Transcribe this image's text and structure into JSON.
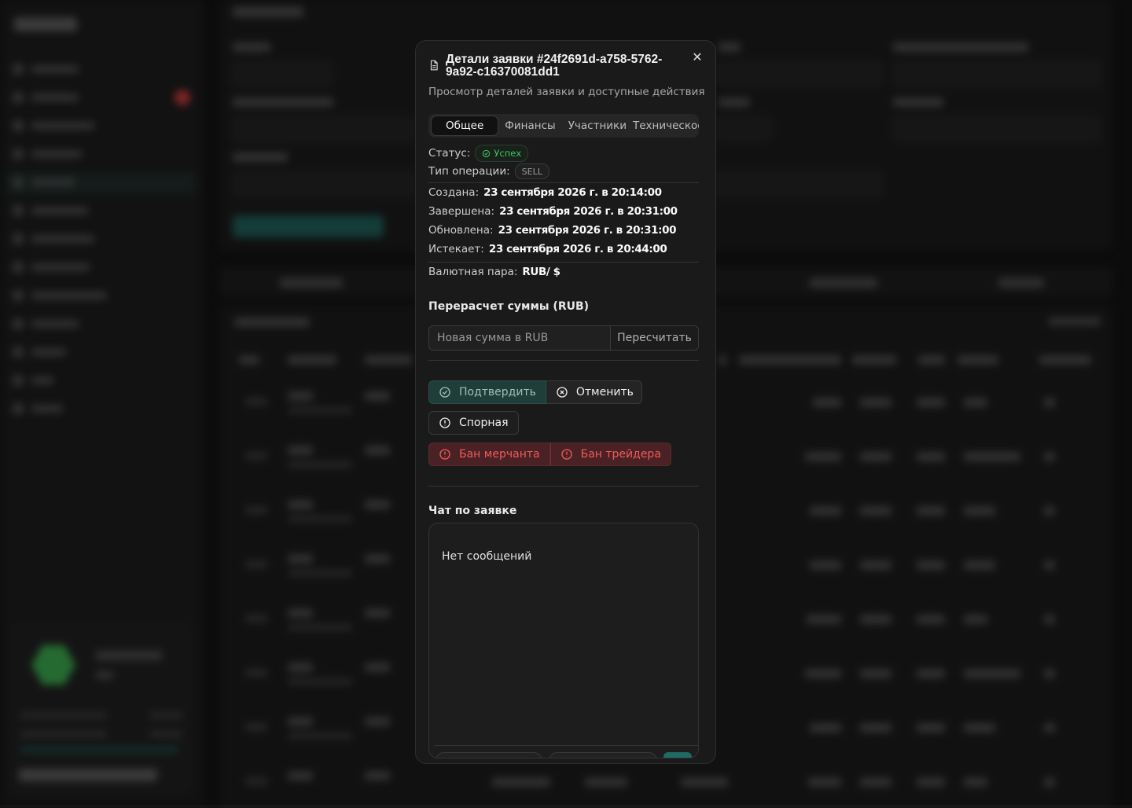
{
  "modal": {
    "title": "Детали заявки #24f2691d-a758-5762-9a92-c16370081dd1",
    "description": "Просмотр деталей заявки и доступные действия",
    "close_symbol": "✕",
    "tabs": [
      {
        "label": "Общее",
        "active": true
      },
      {
        "label": "Финансы",
        "active": false
      },
      {
        "label": "Участники",
        "active": false
      },
      {
        "label": "Техническое",
        "active": false
      }
    ],
    "status": {
      "label": "Статус:",
      "value": "Успех",
      "color": "#41c46b"
    },
    "operation_type": {
      "label": "Тип операции:",
      "value": "SELL"
    },
    "dates": {
      "created_label": "Создана:",
      "created": "23 сентября 2026 г. в 20:14:00",
      "completed_label": "Завершена:",
      "completed": "23 сентября 2026 г. в 20:31:00",
      "updated_label": "Обновлена:",
      "updated": "23 сентября 2026 г. в 20:31:00",
      "expires_label": "Истекает:",
      "expires": "23 сентября 2026 г. в 20:44:00"
    },
    "currency_pair": {
      "label": "Валютная пара:",
      "value": "RUB/ $"
    },
    "recalc": {
      "title": "Перерасчет суммы (RUB)",
      "placeholder": "Новая сумма в RUB",
      "button": "Пересчитать"
    },
    "actions": {
      "confirm": "Подтвердить",
      "cancel": "Отменить",
      "dispute": "Спорная",
      "ban_merchant": "Бан мерчанта",
      "ban_trader": "Бан трейдера"
    },
    "chat": {
      "title": "Чат по заявке",
      "empty": "Нет сообщений"
    }
  },
  "colors": {
    "accent": "#1f6b63",
    "danger": "#ef5b5b",
    "success": "#41c46b"
  }
}
